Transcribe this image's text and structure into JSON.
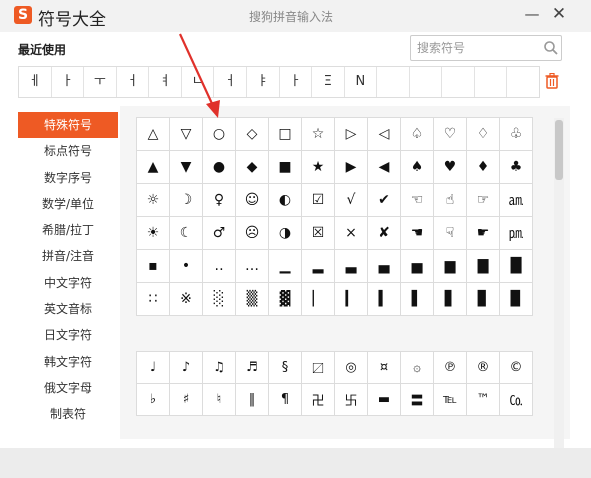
{
  "window": {
    "app_title": "符号大全",
    "center_title": "搜狗拼音输入法",
    "logo_letter": "S",
    "minimize_glyph": "—",
    "close_glyph": "✕"
  },
  "recent": {
    "label": "最近使用",
    "items": [
      "ㅔ",
      "ㅏ",
      "ㅜ",
      "ㅓ",
      "ㅕ",
      "ㄴ",
      "ㅓ",
      "ㅑ",
      "ㅏ",
      "Ξ",
      "N",
      "",
      "",
      "",
      "",
      ""
    ]
  },
  "search": {
    "placeholder": "搜索符号"
  },
  "sidebar": {
    "items": [
      {
        "label": "特殊符号",
        "active": true
      },
      {
        "label": "标点符号",
        "active": false
      },
      {
        "label": "数字序号",
        "active": false
      },
      {
        "label": "数学/单位",
        "active": false
      },
      {
        "label": "希腊/拉丁",
        "active": false
      },
      {
        "label": "拼音/注音",
        "active": false
      },
      {
        "label": "中文字符",
        "active": false
      },
      {
        "label": "英文音标",
        "active": false
      },
      {
        "label": "日文字符",
        "active": false
      },
      {
        "label": "韩文字符",
        "active": false
      },
      {
        "label": "俄文字母",
        "active": false
      },
      {
        "label": "制表符",
        "active": false
      }
    ]
  },
  "grid1": [
    [
      "△",
      "▽",
      "○",
      "◇",
      "□",
      "☆",
      "▷",
      "◁",
      "♤",
      "♡",
      "♢",
      "♧"
    ],
    [
      "▲",
      "▼",
      "●",
      "◆",
      "■",
      "★",
      "▶",
      "◀",
      "♠",
      "♥",
      "♦",
      "♣"
    ],
    [
      "☼",
      "☽",
      "♀",
      "☺",
      "◐",
      "☑",
      "√",
      "✔",
      "☜",
      "☝",
      "☞",
      "㏂"
    ],
    [
      "☀",
      "☾",
      "♂",
      "☹",
      "◑",
      "☒",
      "×",
      "✘",
      "☚",
      "☟",
      "☛",
      "㏘"
    ],
    [
      "▪",
      "•",
      "‥",
      "…",
      "▁",
      "▂",
      "▃",
      "▄",
      "▅",
      "▆",
      "▇",
      "█"
    ],
    [
      "∷",
      "※",
      "░",
      "▒",
      "▓",
      "▏",
      "▎",
      "▍",
      "▌",
      "▋",
      "▊",
      "▉"
    ]
  ],
  "grid2": [
    [
      "♩",
      "♪",
      "♫",
      "♬",
      "§",
      "〼",
      "◎",
      "¤",
      "۞",
      "℗",
      "®",
      "©"
    ],
    [
      "♭",
      "♯",
      "♮",
      "‖",
      "¶",
      "卍",
      "卐",
      "▬",
      "〓",
      "℡",
      "™",
      "㏇"
    ]
  ],
  "colors": {
    "accent": "#ee5a24",
    "arrow": "#e0312b"
  },
  "icons": {
    "search": "search-icon",
    "trash": "trash-icon"
  }
}
